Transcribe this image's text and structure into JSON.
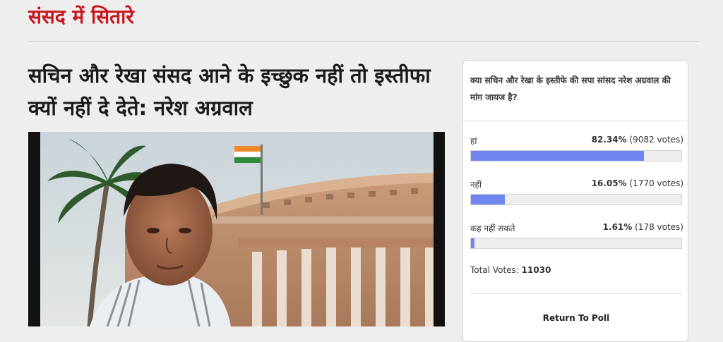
{
  "section": {
    "title": "संसद में सितारे"
  },
  "article": {
    "headline": "सचिन और रेखा संसद आने के इच्छुक नहीं तो इस्तीफा क्यों नहीं दे देते: नरेश अग्रवाल"
  },
  "poll": {
    "question": "क्या सचिन और रेखा के इस्तीफे की सपा सांसद नरेश अग्रवाल की मांग जायज है?",
    "options": [
      {
        "label": "हां",
        "percent": "82.34%",
        "votes": "(9082 votes)",
        "fraction": 0.8234
      },
      {
        "label": "नहीं",
        "percent": "16.05%",
        "votes": "(1770 votes)",
        "fraction": 0.1605
      },
      {
        "label": "कह नहीं सकते",
        "percent": "1.61%",
        "votes": "(178 votes)",
        "fraction": 0.0161
      }
    ],
    "total_label": "Total Votes:",
    "total_value": "11030",
    "return_label": "Return To Poll",
    "bar_color": "#6f86f0"
  },
  "colors": {
    "section_title": "#c8161d",
    "background": "#eeeeee"
  }
}
